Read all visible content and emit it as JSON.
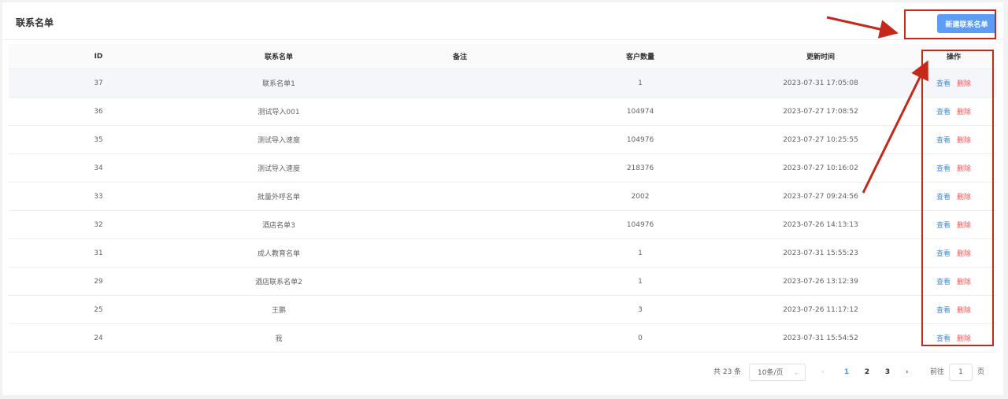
{
  "page": {
    "title": "联系名单"
  },
  "toolbar": {
    "new_label": "新建联系名单"
  },
  "table": {
    "headers": {
      "id": "ID",
      "name": "联系名单",
      "remark": "备注",
      "count": "客户数量",
      "updated": "更新时间",
      "actions": "操作"
    },
    "rows": [
      {
        "id": "37",
        "name": "联系名单1",
        "remark": "",
        "count": "1",
        "updated": "2023-07-31 17:05:08"
      },
      {
        "id": "36",
        "name": "测试导入001",
        "remark": "",
        "count": "104974",
        "updated": "2023-07-27 17:08:52"
      },
      {
        "id": "35",
        "name": "测试导入速度",
        "remark": "",
        "count": "104976",
        "updated": "2023-07-27 10:25:55"
      },
      {
        "id": "34",
        "name": "测试导入速度",
        "remark": "",
        "count": "218376",
        "updated": "2023-07-27 10:16:02"
      },
      {
        "id": "33",
        "name": "批量外呼名单",
        "remark": "",
        "count": "2002",
        "updated": "2023-07-27 09:24:56"
      },
      {
        "id": "32",
        "name": "酒店名单3",
        "remark": "",
        "count": "104976",
        "updated": "2023-07-26 14:13:13"
      },
      {
        "id": "31",
        "name": "成人教育名单",
        "remark": "",
        "count": "1",
        "updated": "2023-07-31 15:55:23"
      },
      {
        "id": "29",
        "name": "酒店联系名单2",
        "remark": "",
        "count": "1",
        "updated": "2023-07-26 13:12:39"
      },
      {
        "id": "25",
        "name": "王鹏",
        "remark": "",
        "count": "3",
        "updated": "2023-07-26 11:17:12"
      },
      {
        "id": "24",
        "name": "我",
        "remark": "",
        "count": "0",
        "updated": "2023-07-31 15:54:52"
      }
    ],
    "actions": {
      "view": "查看",
      "delete": "删除"
    }
  },
  "pagination": {
    "total": "共 23 条",
    "page_size": "10条/页",
    "prev": "‹",
    "pages": [
      "1",
      "2",
      "3"
    ],
    "current": "1",
    "next": "›",
    "goto_label": "前往",
    "goto_value": "1",
    "goto_suffix": "页"
  },
  "annotation_color": "#c4291c"
}
